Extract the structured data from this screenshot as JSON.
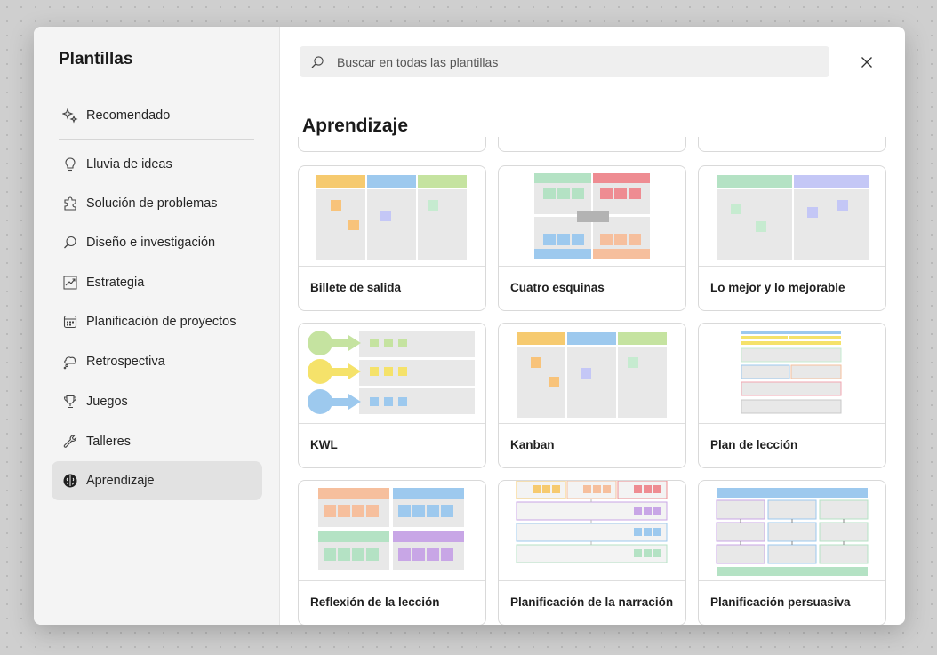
{
  "dialog": {
    "sidebar": {
      "title": "Plantillas",
      "items": [
        {
          "label": "Recomendado",
          "icon": "sparkle-icon"
        },
        {
          "label": "Lluvia de ideas",
          "icon": "lightbulb-icon"
        },
        {
          "label": "Solución de problemas",
          "icon": "puzzle-icon"
        },
        {
          "label": "Diseño e investigación",
          "icon": "search-icon"
        },
        {
          "label": "Estrategia",
          "icon": "chart-trend-icon"
        },
        {
          "label": "Planificación de proyectos",
          "icon": "calendar-icon"
        },
        {
          "label": "Retrospectiva",
          "icon": "thought-bubble-icon"
        },
        {
          "label": "Juegos",
          "icon": "trophy-icon"
        },
        {
          "label": "Talleres",
          "icon": "wrench-icon"
        },
        {
          "label": "Aprendizaje",
          "icon": "brain-icon",
          "active": true
        }
      ]
    },
    "search": {
      "placeholder": "Buscar en todas las plantillas",
      "value": ""
    },
    "section_title": "Aprendizaje",
    "templates": [
      {
        "label": "Billete de salida"
      },
      {
        "label": "Cuatro esquinas"
      },
      {
        "label": "Lo mejor y lo mejorable"
      },
      {
        "label": "KWL"
      },
      {
        "label": "Kanban"
      },
      {
        "label": "Plan de lección"
      },
      {
        "label": "Reflexión de la lección"
      },
      {
        "label": "Planificación de la narración"
      },
      {
        "label": "Planificación persuasiva"
      }
    ]
  }
}
